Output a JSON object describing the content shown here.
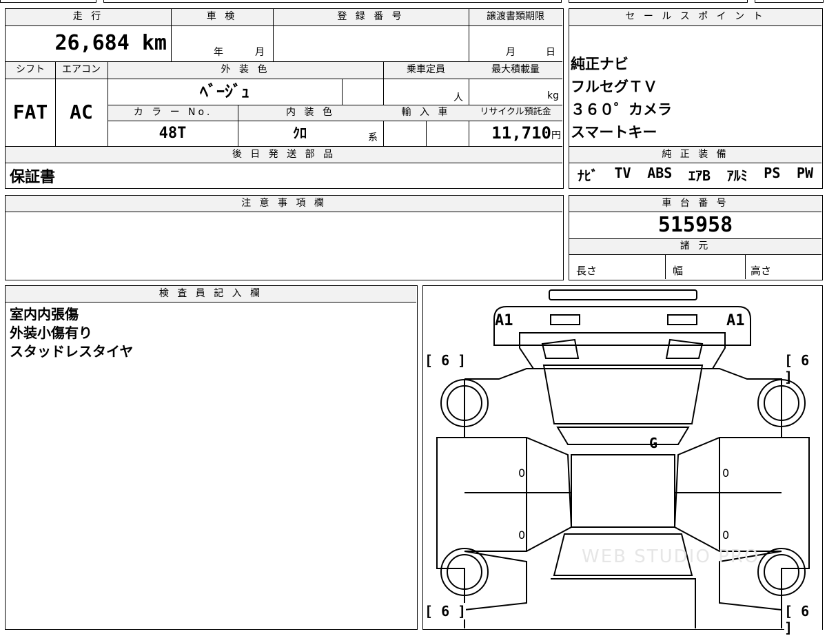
{
  "top": {
    "mileage_header": "走 行",
    "mileage_value": "26,684",
    "mileage_unit": "km",
    "inspection_header": "車 検",
    "inspection_year": "年",
    "inspection_month": "月",
    "registration_header": "登 録 番 号",
    "deadline_header": "譲渡書類期限",
    "deadline_month": "月",
    "deadline_day": "日",
    "shift_header": "シフト",
    "aircon_header": "エアコン",
    "exterior_header": "外 装 色",
    "capacity_header": "乗車定員",
    "capacity_unit": "人",
    "maxload_header": "最大積載量",
    "maxload_unit": "kg",
    "shift_value": "FAT",
    "aircon_value": "AC",
    "exterior_value": "ﾍﾞｰｼﾞｭ",
    "color_no_header": "カ ラ ー No.",
    "interior_header": "内 装 色",
    "import_header": "輸 入 車",
    "recycle_header": "リサイクル預託金",
    "color_no_value": "48T",
    "interior_value": "ｸﾛ",
    "interior_suffix": "系",
    "recycle_value": "11,710",
    "recycle_unit": "円",
    "later_parts_header": "後 日 発 送 部 品",
    "later_parts_value": "保証書"
  },
  "sales": {
    "header": "セ ー ル ス ポ イ ン ト",
    "points": [
      "純正ナビ",
      "フルセグＴＶ",
      "３６０゜カメラ",
      "スマートキー"
    ]
  },
  "equipment": {
    "header": "純 正 装 備",
    "items": [
      "ﾅﾋﾞ",
      "TV",
      "ABS",
      "ｴｱB",
      "ｱﾙﾐ",
      "PS",
      "PW"
    ]
  },
  "caution": {
    "header": "注 意 事 項 欄"
  },
  "chassis": {
    "header": "車 台 番 号",
    "value": "515958"
  },
  "specs": {
    "header": "諸 元",
    "length": "長さ",
    "width": "幅",
    "height": "高さ"
  },
  "inspector": {
    "header": "検 査 員 記 入 欄",
    "lines": [
      "室内内張傷",
      "外装小傷有り",
      "スタッドレスタイヤ"
    ]
  },
  "diagram": {
    "front_left_mark": "A1",
    "front_right_mark": "A1",
    "tire_fl": "[ 6 ]",
    "tire_fr": "[ 6 ]",
    "tire_rl": "[ 6 ]",
    "tire_rr": "[ 6 ]",
    "windshield_mark": "G",
    "door_lf": "0",
    "door_lr": "0",
    "door_rf": "0",
    "door_rr": "0",
    "watermark": "WEB STUDIO PRO"
  }
}
